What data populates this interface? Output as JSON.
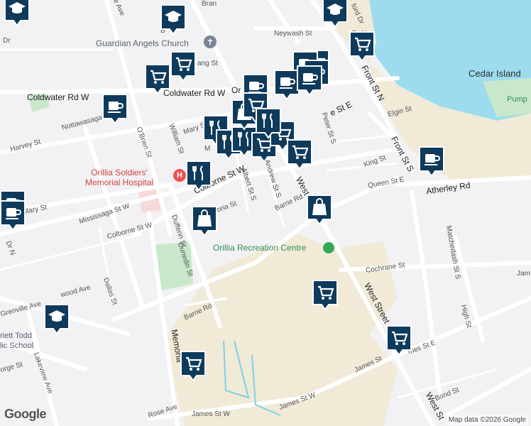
{
  "map": {
    "attribution": "Map data ©2026 Google",
    "logo": "Google"
  },
  "labels": {
    "guardian_angels": "Guardian Angels Church",
    "cedar_island": "Cedar Island",
    "pump": "Pump",
    "hospital_line1": "Orillia Soldiers'",
    "hospital_line2": "Memorial Hospital",
    "rec_centre": "Orillia Recreation Centre",
    "school_line1": "riett Todd",
    "school_line2": "lic School",
    "neywash": "Neywash St",
    "coldwater": "Coldwater Rd W",
    "coldwater_end": "Or",
    "nottawasaga": "Nottawasaga St",
    "harvey": "Harvey St",
    "obrien": "O'Brien St",
    "william": "William St",
    "mary": "Mary St",
    "mary_top": "Mary S",
    "mary_m": "M",
    "mississaga": "Mississaga St W",
    "colborne_e": "Colborne St W",
    "colborne_w": "Colborne St W",
    "dufferin": "Dufferin St",
    "dunedin": "Dunedin St",
    "albert": "Albert St S",
    "andrew": "Andrew St S",
    "victoria": "oria St",
    "barrie": "Barrie Rd",
    "barrie_lower": "Barrie Rd",
    "dallas": "Dallas St",
    "grenville": "Grenville Ave",
    "wood": "wood Ave",
    "lakeview": "Lakeview Ave",
    "george": "orge St",
    "memorial": "Memoria",
    "rose": "Rose Ave",
    "james_w1": "James St W",
    "james_w2": "James St W",
    "james_mid": "James St",
    "james_e": "mes St E",
    "bond": "Bond St",
    "high": "High St",
    "cochrane": "Cochrane St",
    "matchedash": "Matchedash St S",
    "west_st_upper": "West S",
    "west_st_mid": "West Street",
    "west_st_low": "West St",
    "front_n": "Front St N",
    "front_s": "Front St S",
    "king": "King St",
    "queen": "Queen St E",
    "elgin": "Elgin St",
    "peter": "Peter St S",
    "colborne_st_e": "e St E",
    "atherley": "Atherley Rd",
    "jam_far": "Jam",
    "dr_n": "Dr N",
    "dr_left": "Dr",
    "ang": "ang St",
    "bran": "Bran",
    "be_ave": "e Ave",
    "ford_dr": "ford Dr",
    "dr_n2": "Dr N",
    "b_letter": "B"
  },
  "markers": [
    {
      "type": "school",
      "icon": "school-icon"
    },
    {
      "type": "school",
      "icon": "school-icon"
    },
    {
      "type": "grocery",
      "icon": "shopping-cart-icon"
    },
    {
      "type": "grocery",
      "icon": "shopping-cart-icon"
    },
    {
      "type": "grocery",
      "icon": "shopping-cart-icon"
    },
    {
      "type": "grocery",
      "icon": "shopping-cart-icon"
    },
    {
      "type": "cafe",
      "icon": "coffee-cup-icon"
    },
    {
      "type": "cafe",
      "icon": "coffee-cup-icon"
    },
    {
      "type": "cafe",
      "icon": "coffee-cup-icon"
    },
    {
      "type": "cafe",
      "icon": "coffee-cup-icon"
    },
    {
      "type": "cafe",
      "icon": "coffee-cup-icon"
    },
    {
      "type": "restaurant",
      "icon": "fork-knife-icon"
    },
    {
      "type": "restaurant",
      "icon": "fork-knife-icon"
    },
    {
      "type": "restaurant",
      "icon": "fork-knife-icon"
    },
    {
      "type": "restaurant",
      "icon": "fork-knife-icon"
    },
    {
      "type": "store",
      "icon": "shopping-bag-icon"
    },
    {
      "type": "store",
      "icon": "shopping-bag-icon"
    },
    {
      "type": "store",
      "icon": "shopping-bag-icon"
    },
    {
      "type": "grocery",
      "icon": "shopping-cart-icon"
    },
    {
      "type": "grocery",
      "icon": "shopping-cart-icon"
    },
    {
      "type": "grocery",
      "icon": "shopping-cart-icon"
    },
    {
      "type": "grocery",
      "icon": "shopping-cart-icon"
    },
    {
      "type": "grocery",
      "icon": "shopping-cart-icon"
    },
    {
      "type": "grocery",
      "icon": "shopping-cart-icon"
    },
    {
      "type": "school",
      "icon": "school-icon"
    },
    {
      "type": "school",
      "icon": "school-icon"
    },
    {
      "type": "cafe",
      "icon": "coffee-cup-icon"
    },
    {
      "type": "cafe",
      "icon": "coffee-cup-icon"
    },
    {
      "type": "cafe",
      "icon": "coffee-cup-icon"
    },
    {
      "type": "grocery",
      "icon": "shopping-cart-icon"
    },
    {
      "type": "restaurant",
      "icon": "fork-knife-icon"
    },
    {
      "type": "cafe",
      "icon": "coffee-cup-icon"
    }
  ],
  "colors": {
    "marker": "#0e3a5c",
    "water": "#9ddcef",
    "park": "#c9e8cb",
    "road": "#ffffff",
    "sand": "#f0ead7",
    "hospital": "#e8544e",
    "rec_pin": "#34a853"
  }
}
